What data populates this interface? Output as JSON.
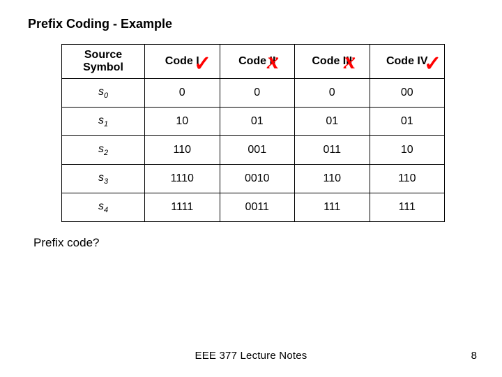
{
  "title": "Prefix Coding - Example",
  "headers": {
    "sym": "Source Symbol",
    "c1": "Code I",
    "c2": "Code II",
    "c3": "Code III",
    "c4": "Code IV"
  },
  "marks": {
    "c1": "✓",
    "c2": "x",
    "c3": "x",
    "c4": "✓"
  },
  "rows": [
    {
      "sym_base": "s",
      "sym_sub": "0",
      "c1": "0",
      "c2": "0",
      "c3": "0",
      "c4": "00"
    },
    {
      "sym_base": "s",
      "sym_sub": "1",
      "c1": "10",
      "c2": "01",
      "c3": "01",
      "c4": "01"
    },
    {
      "sym_base": "s",
      "sym_sub": "2",
      "c1": "110",
      "c2": "001",
      "c3": "011",
      "c4": "10"
    },
    {
      "sym_base": "s",
      "sym_sub": "3",
      "c1": "1110",
      "c2": "0010",
      "c3": "110",
      "c4": "110"
    },
    {
      "sym_base": "s",
      "sym_sub": "4",
      "c1": "1111",
      "c2": "0011",
      "c3": "111",
      "c4": "111"
    }
  ],
  "question": "Prefix code?",
  "footer": {
    "center": "EEE 377 Lecture Notes",
    "page": "8"
  }
}
